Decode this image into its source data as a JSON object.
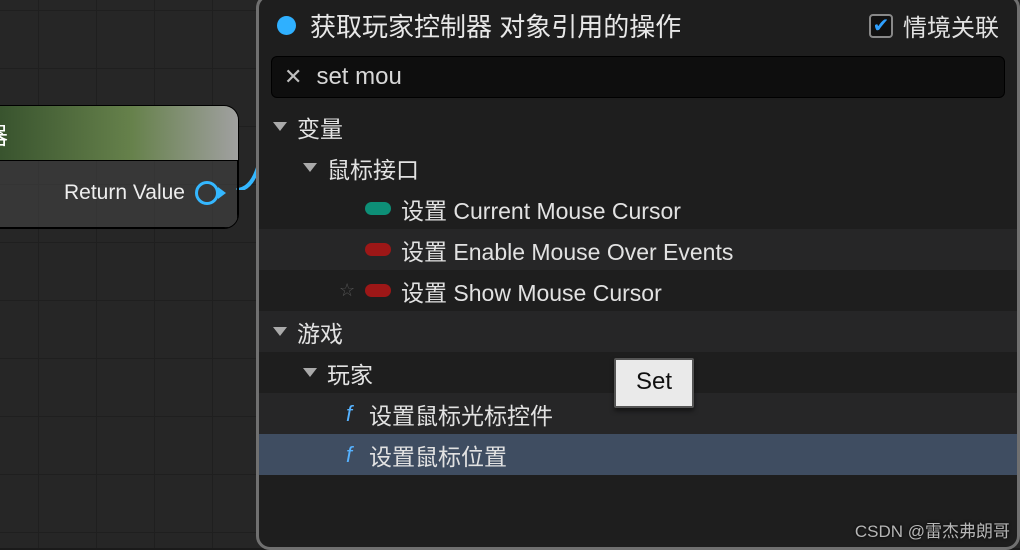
{
  "source_node": {
    "title_suffix": "器",
    "output_pin_label": "Return Value"
  },
  "panel": {
    "title": "获取玩家控制器 对象引用的操作",
    "context_sensitive_label": "情境关联",
    "context_sensitive_checked": true,
    "search_value": "set mou",
    "tooltip": "Set"
  },
  "tree": {
    "cat_variables": "变量",
    "cat_mouse_interface": "鼠标接口",
    "items_mouse": [
      "设置 Current Mouse Cursor",
      "设置 Enable Mouse Over Events",
      "设置 Show Mouse Cursor"
    ],
    "cat_game": "游戏",
    "cat_player": "玩家",
    "items_player": [
      "设置鼠标光标控件",
      "设置鼠标位置"
    ]
  },
  "watermark": "CSDN @雷杰弗朗哥"
}
